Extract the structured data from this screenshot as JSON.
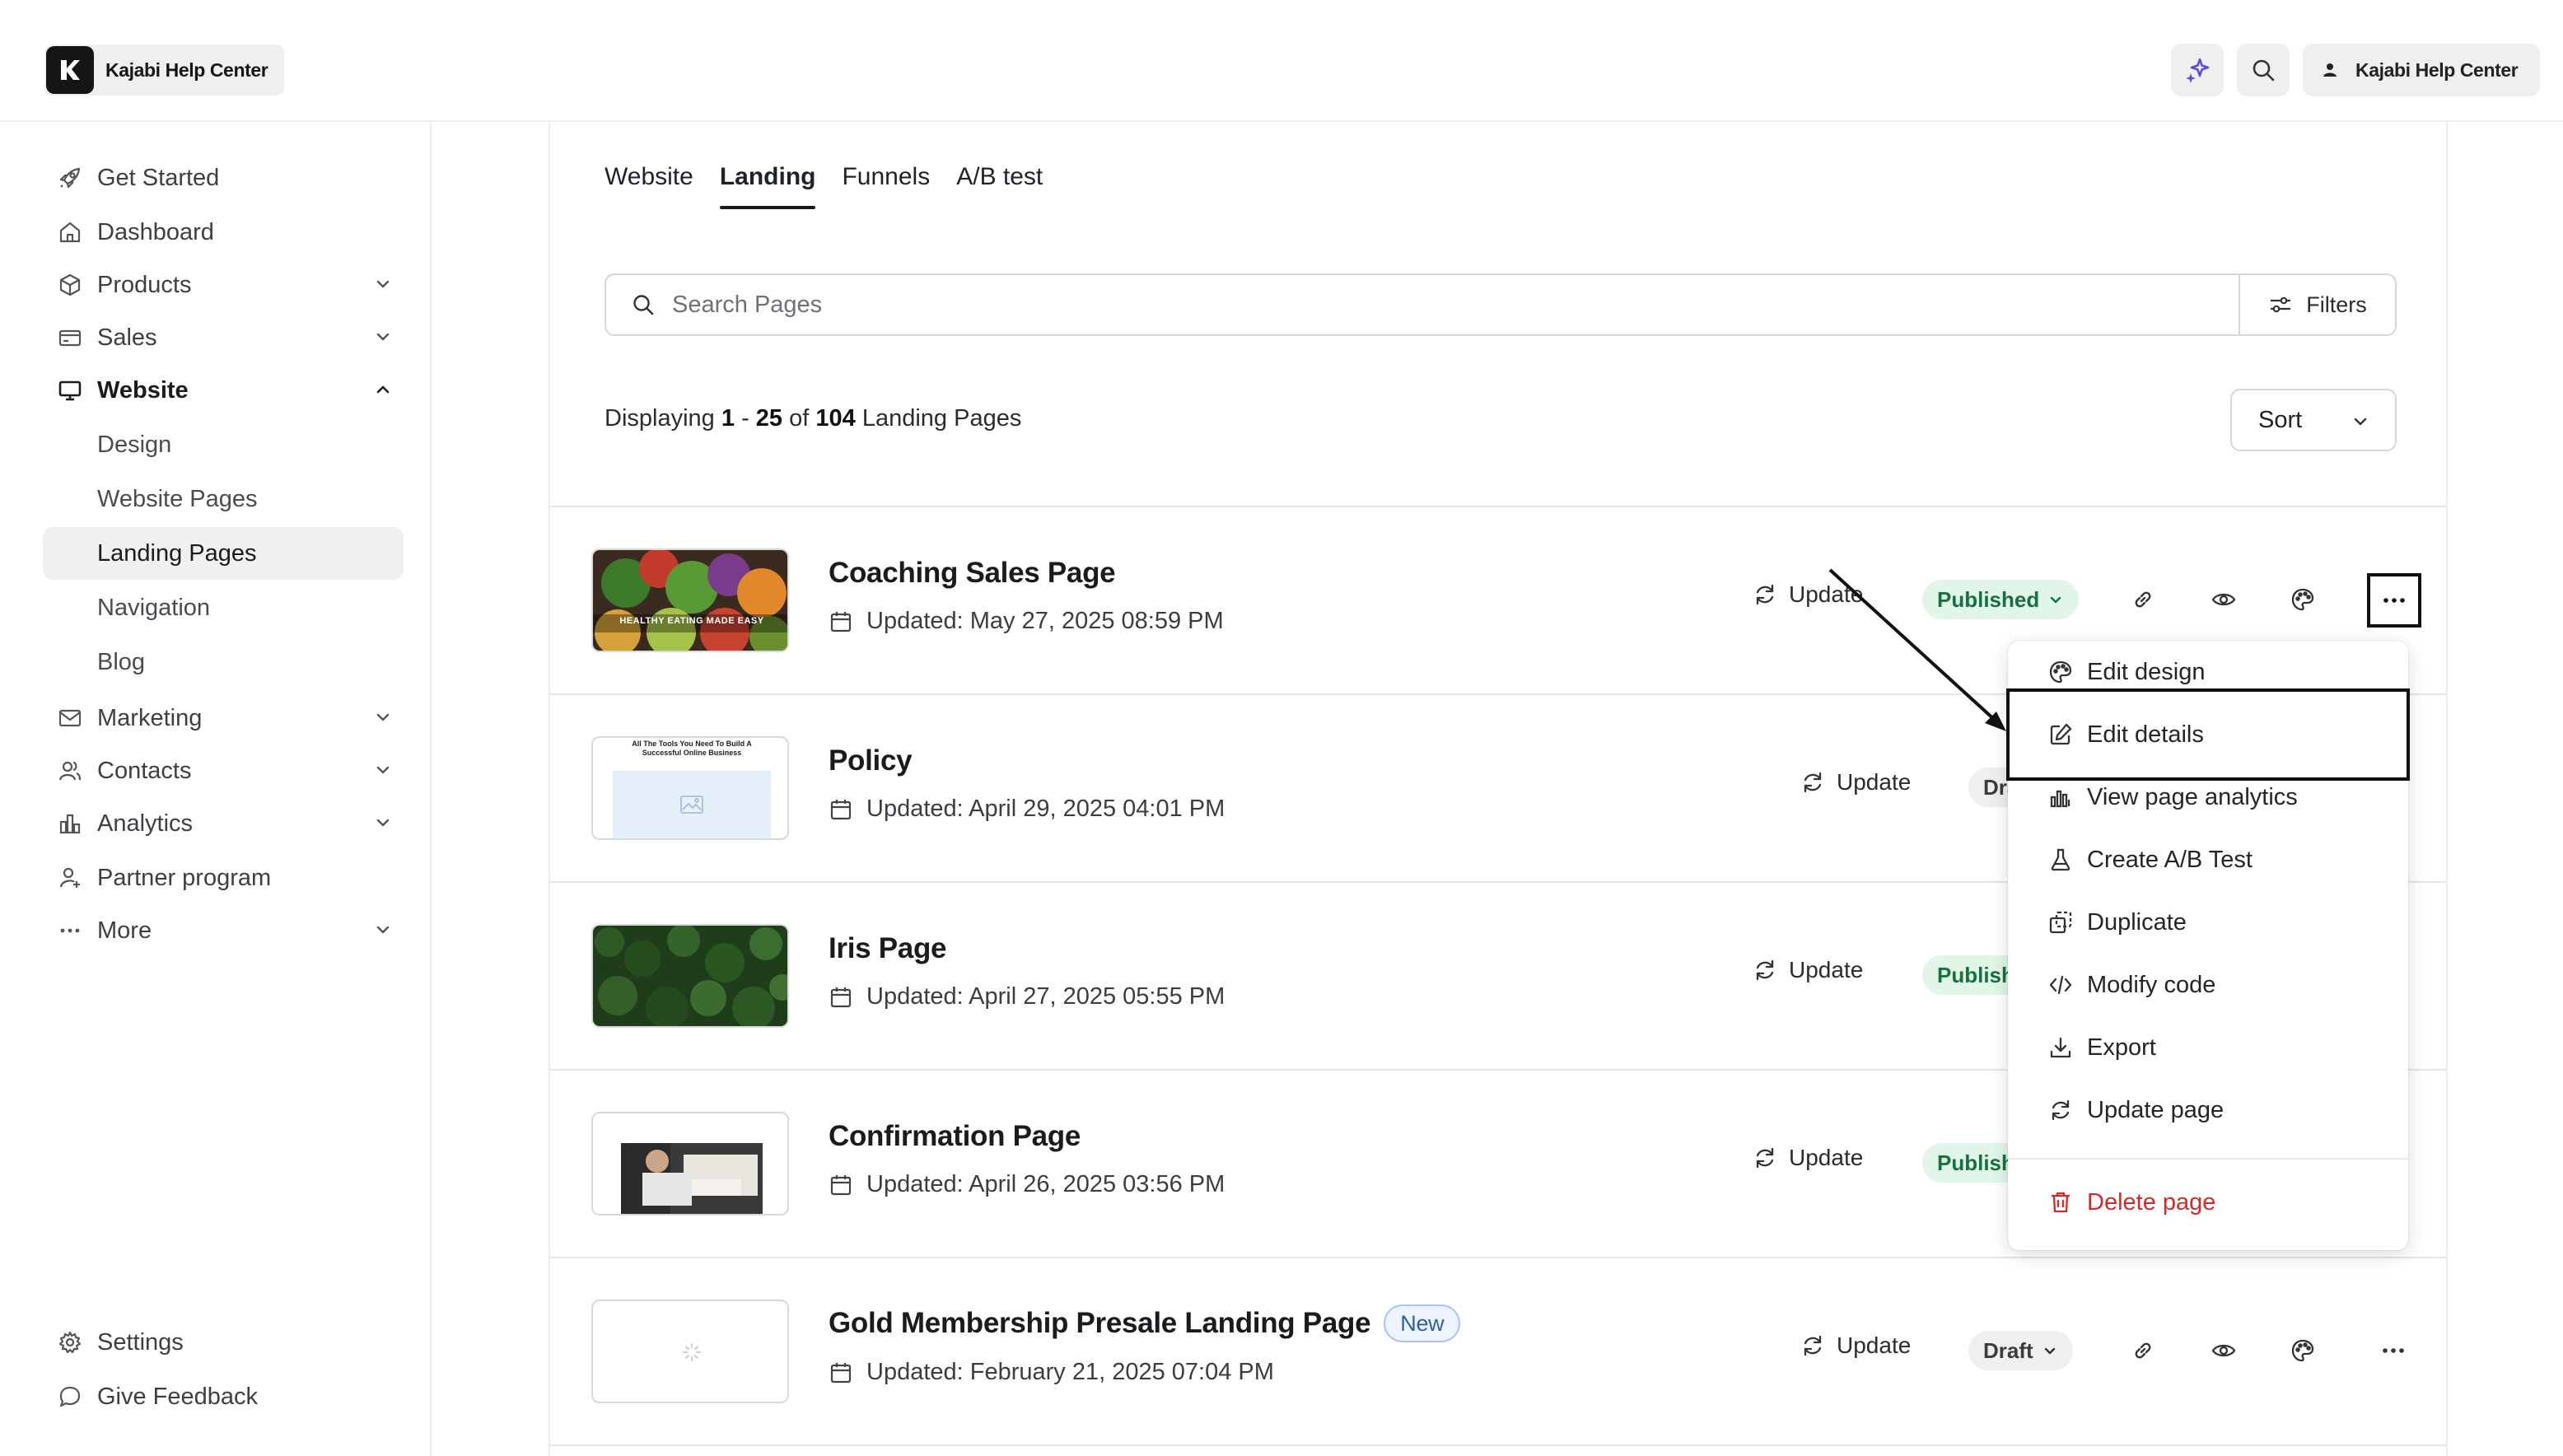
{
  "topbar": {
    "brand": "Kajabi Help Center",
    "profile_label": "Kajabi Help Center"
  },
  "sidebar": {
    "items": [
      {
        "label": "Get Started",
        "icon": "rocket-icon"
      },
      {
        "label": "Dashboard",
        "icon": "home-icon"
      },
      {
        "label": "Products",
        "icon": "box-icon"
      },
      {
        "label": "Sales",
        "icon": "card-icon"
      },
      {
        "label": "Website",
        "icon": "monitor-icon"
      },
      {
        "label": "Marketing",
        "icon": "mail-icon"
      },
      {
        "label": "Contacts",
        "icon": "users-icon"
      },
      {
        "label": "Analytics",
        "icon": "bar-chart-icon"
      },
      {
        "label": "Partner program",
        "icon": "partner-icon"
      },
      {
        "label": "More",
        "icon": "ellipsis-icon"
      }
    ],
    "website_sub": [
      "Design",
      "Website Pages",
      "Landing Pages",
      "Navigation",
      "Blog"
    ],
    "footer": [
      {
        "label": "Settings",
        "icon": "gear-icon"
      },
      {
        "label": "Give Feedback",
        "icon": "chat-icon"
      }
    ]
  },
  "tabs": [
    "Website",
    "Landing",
    "Funnels",
    "A/B test"
  ],
  "search": {
    "placeholder": "Search Pages",
    "filters_label": "Filters"
  },
  "display": {
    "prefix": "Displaying",
    "start": "1",
    "sep": "-",
    "end": "25",
    "of": "of",
    "total": "104",
    "suffix": "Landing Pages"
  },
  "sort_label": "Sort",
  "rows": [
    {
      "title": "Coaching Sales Page",
      "updated": "Updated: May 27, 2025 08:59 PM",
      "update_label": "Update",
      "status": "Published",
      "thumb_text": "HEALTHY EATING MADE EASY"
    },
    {
      "title": "Policy",
      "updated": "Updated: April 29, 2025 04:01 PM",
      "update_label": "Update",
      "status": "Dra",
      "thumb_text": "All The Tools You Need To Build A Successful Online Business"
    },
    {
      "title": "Iris Page",
      "updated": "Updated: April 27, 2025 05:55 PM",
      "update_label": "Update",
      "status": "Publishe"
    },
    {
      "title": "Confirmation Page",
      "updated": "Updated: April 26, 2025 03:56 PM",
      "update_label": "Update",
      "status": "Publishe"
    },
    {
      "title": "Gold Membership Presale Landing Page",
      "badge": "New",
      "updated": "Updated: February 21, 2025 07:04 PM",
      "update_label": "Update",
      "status": "Draft"
    }
  ],
  "menu": {
    "items": [
      {
        "label": "Edit design",
        "icon": "palette-icon"
      },
      {
        "label": "Edit details",
        "icon": "edit-icon"
      },
      {
        "label": "View page analytics",
        "icon": "analytics-icon"
      },
      {
        "label": "Create A/B Test",
        "icon": "flask-icon"
      },
      {
        "label": "Duplicate",
        "icon": "duplicate-icon"
      },
      {
        "label": "Modify code",
        "icon": "code-icon"
      },
      {
        "label": "Export",
        "icon": "download-icon"
      },
      {
        "label": "Update page",
        "icon": "refresh-icon"
      }
    ],
    "delete_label": "Delete page"
  },
  "colors": {
    "published_bg": "#e1f5e8",
    "published_text": "#16713f",
    "danger": "#d22a2a",
    "sparkle": "#5b4ce0"
  }
}
